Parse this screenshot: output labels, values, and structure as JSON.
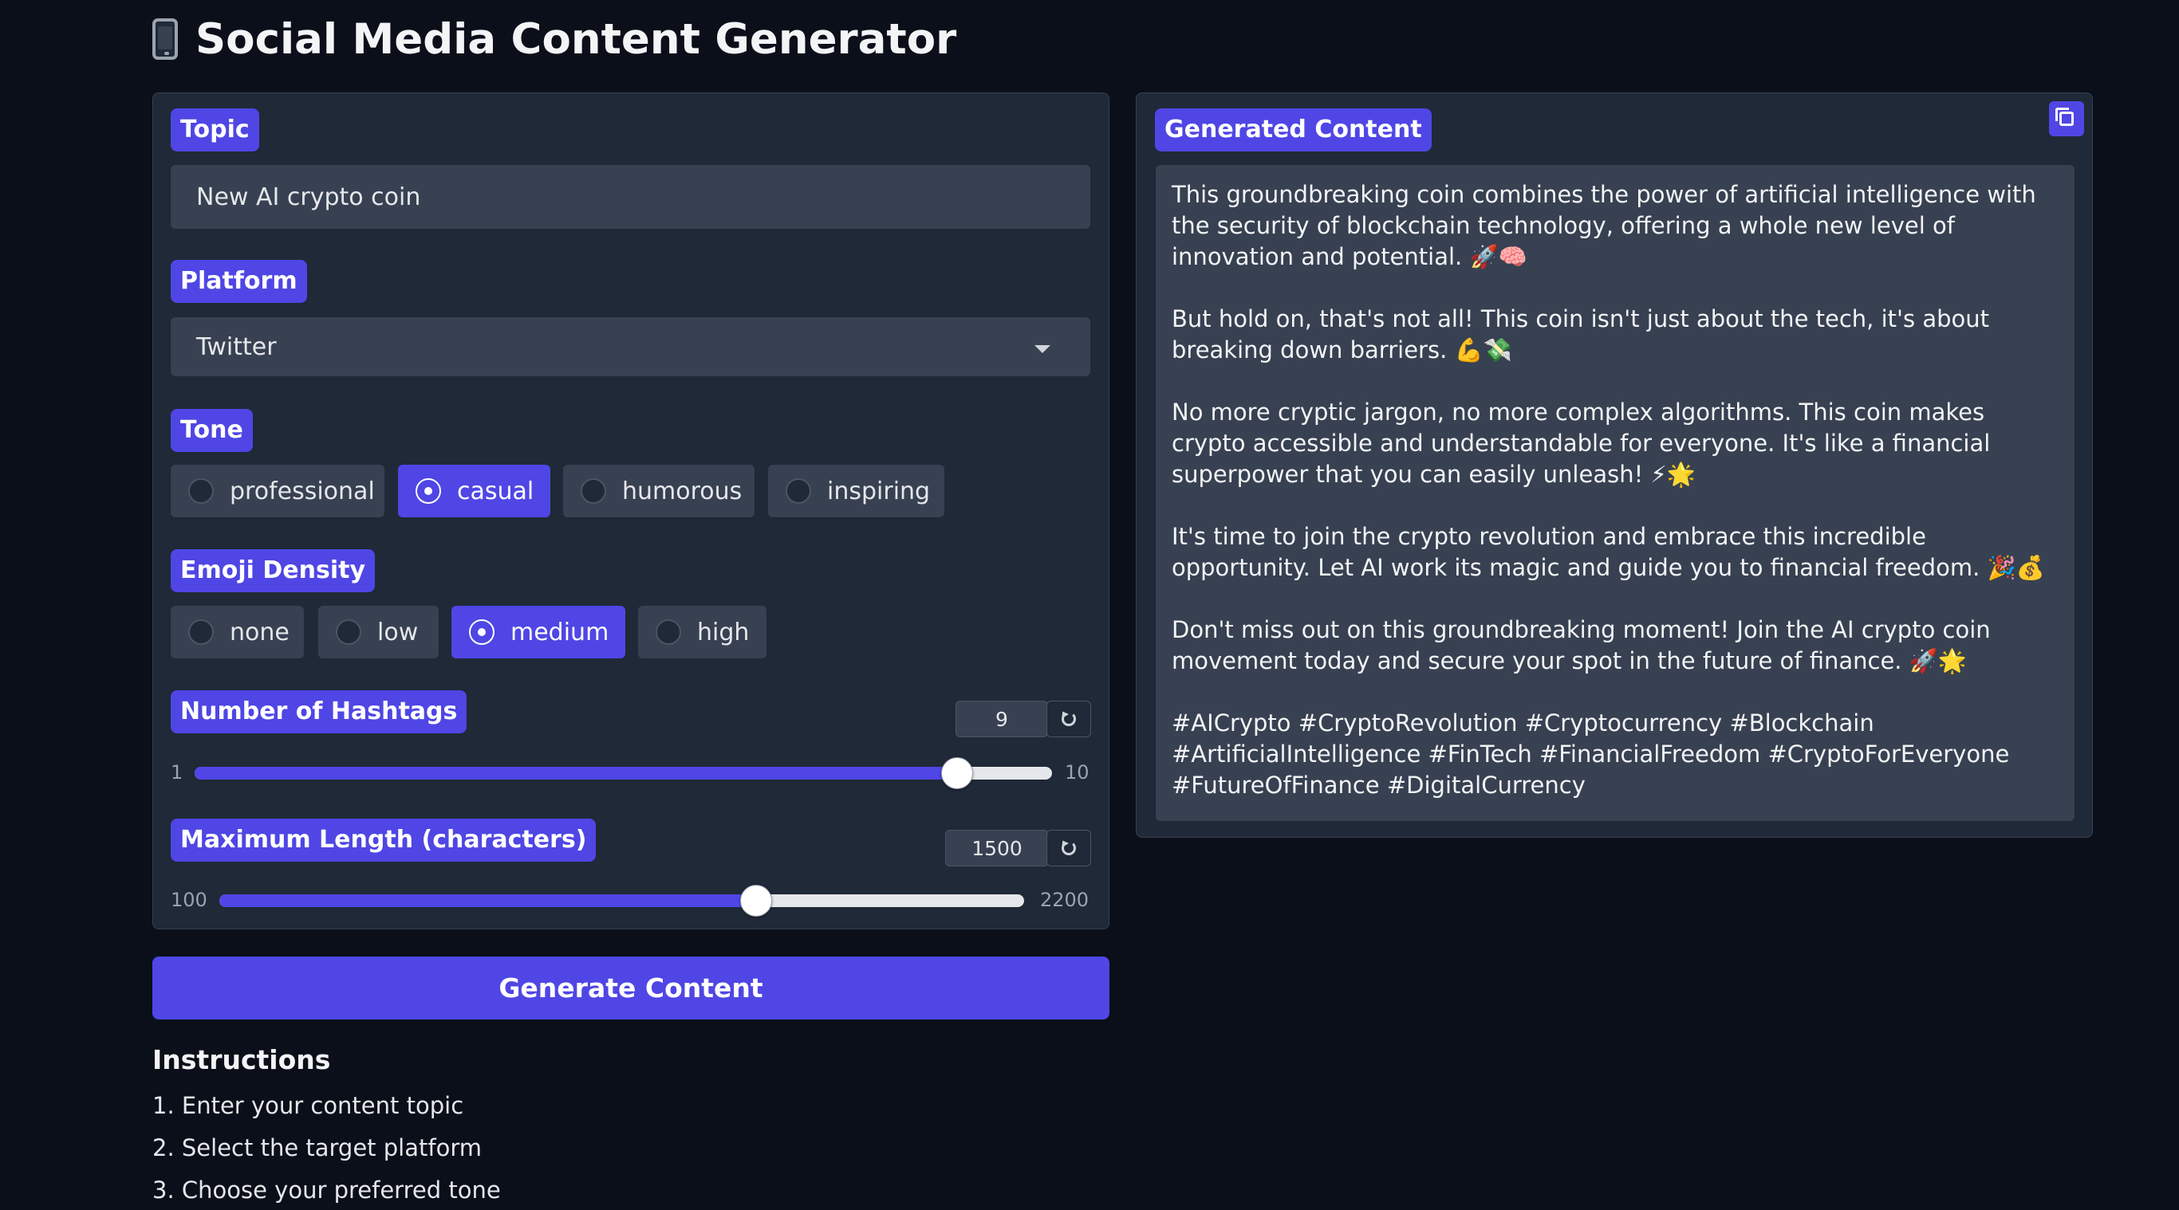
{
  "header": {
    "title": "Social Media Content Generator",
    "icon": "mobile-phone-icon"
  },
  "form": {
    "topic": {
      "label": "Topic",
      "value": "New AI crypto coin"
    },
    "platform": {
      "label": "Platform",
      "value": "Twitter"
    },
    "tone": {
      "label": "Tone",
      "options": [
        "professional",
        "casual",
        "humorous",
        "inspiring"
      ],
      "selected": "casual"
    },
    "emoji_density": {
      "label": "Emoji Density",
      "options": [
        "none",
        "low",
        "medium",
        "high"
      ],
      "selected": "medium"
    },
    "hashtags": {
      "label": "Number of Hashtags",
      "value": "9",
      "min": "1",
      "max": "10",
      "fraction": 0.889
    },
    "max_length": {
      "label": "Maximum Length (characters)",
      "value": "1500",
      "min": "100",
      "max": "2200",
      "fraction": 0.667
    },
    "generate_label": "Generate Content"
  },
  "instructions": {
    "title": "Instructions",
    "items": [
      "1. Enter your content topic",
      "2. Select the target platform",
      "3. Choose your preferred tone"
    ]
  },
  "output": {
    "label": "Generated Content",
    "paragraphs": [
      "This groundbreaking coin combines the power of artificial intelligence with the security of blockchain technology, offering a whole new level of innovation and potential. 🚀🧠",
      "But hold on, that's not all! This coin isn't just about the tech, it's about breaking down barriers. 💪💸",
      "No more cryptic jargon, no more complex algorithms. This coin makes crypto accessible and understandable for everyone. It's like a financial superpower that you can easily unleash! ⚡🌟",
      "It's time to join the crypto revolution and embrace this incredible opportunity. Let AI work its magic and guide you to financial freedom. 🎉💰",
      "Don't miss out on this groundbreaking moment! Join the AI crypto coin movement today and secure your spot in the future of finance. 🚀🌟",
      "#AICrypto #CryptoRevolution #Cryptocurrency #Blockchain #ArtificialIntelligence #FinTech #FinancialFreedom #CryptoForEveryone #FutureOfFinance #DigitalCurrency"
    ]
  },
  "colors": {
    "accent": "#4f46e5",
    "background": "#0b0f19",
    "panel": "#1f2937",
    "field": "#374151"
  }
}
